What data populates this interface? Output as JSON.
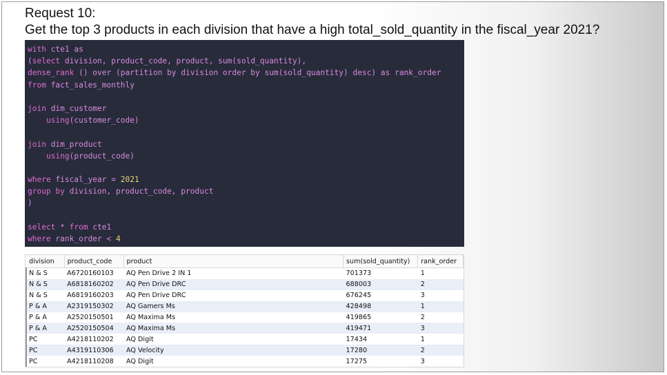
{
  "slide": {
    "title": "Request 10:",
    "question": "Get the top 3 products in each division that have a high total_sold_quantity in the fiscal_year 2021?"
  },
  "code": {
    "l1_kw": "with",
    "l1_rest": " cte1 as",
    "l2_a": "(",
    "l2_kw": "select",
    "l2_rest": " division, product_code, product, sum(sold_quantity),",
    "l3_fn": "dense_rank",
    "l3_rest": " () over (partition by division order by sum(sold_quantity) desc) as rank_order",
    "l4_kw": "from",
    "l4_rest": " fact_sales_monthly",
    "l6_kw": "join",
    "l6_rest": " dim_customer",
    "l7_indent": "    ",
    "l7_fn": "using",
    "l7_rest": "(customer_code)",
    "l9_kw": "join",
    "l9_rest": " dim_product",
    "l10_indent": "    ",
    "l10_fn": "using",
    "l10_rest": "(product_code)",
    "l12_kw": "where",
    "l12_rest": " fiscal_year = ",
    "l12_num": "2021",
    "l13_kw": "group by",
    "l13_rest": " division, product_code, product",
    "l14": ")",
    "l16_kw": "select",
    "l16_rest": " * ",
    "l16_kw2": "from",
    "l16_rest2": " cte1",
    "l17_kw": "where",
    "l17_rest": " rank_order < ",
    "l17_num": "4"
  },
  "result": {
    "columns": [
      "division",
      "product_code",
      "product",
      "sum(sold_quantity)",
      "rank_order"
    ],
    "rows": [
      [
        "N & S",
        "A6720160103",
        "AQ Pen Drive 2 IN 1",
        "701373",
        "1"
      ],
      [
        "N & S",
        "A6818160202",
        "AQ Pen Drive DRC",
        "688003",
        "2"
      ],
      [
        "N & S",
        "A6819160203",
        "AQ Pen Drive DRC",
        "676245",
        "3"
      ],
      [
        "P & A",
        "A2319150302",
        "AQ Gamers Ms",
        "428498",
        "1"
      ],
      [
        "P & A",
        "A2520150501",
        "AQ Maxima Ms",
        "419865",
        "2"
      ],
      [
        "P & A",
        "A2520150504",
        "AQ Maxima Ms",
        "419471",
        "3"
      ],
      [
        "PC",
        "A4218110202",
        "AQ Digit",
        "17434",
        "1"
      ],
      [
        "PC",
        "A4319110306",
        "AQ Velocity",
        "17280",
        "2"
      ],
      [
        "PC",
        "A4218110208",
        "AQ Digit",
        "17275",
        "3"
      ]
    ]
  }
}
